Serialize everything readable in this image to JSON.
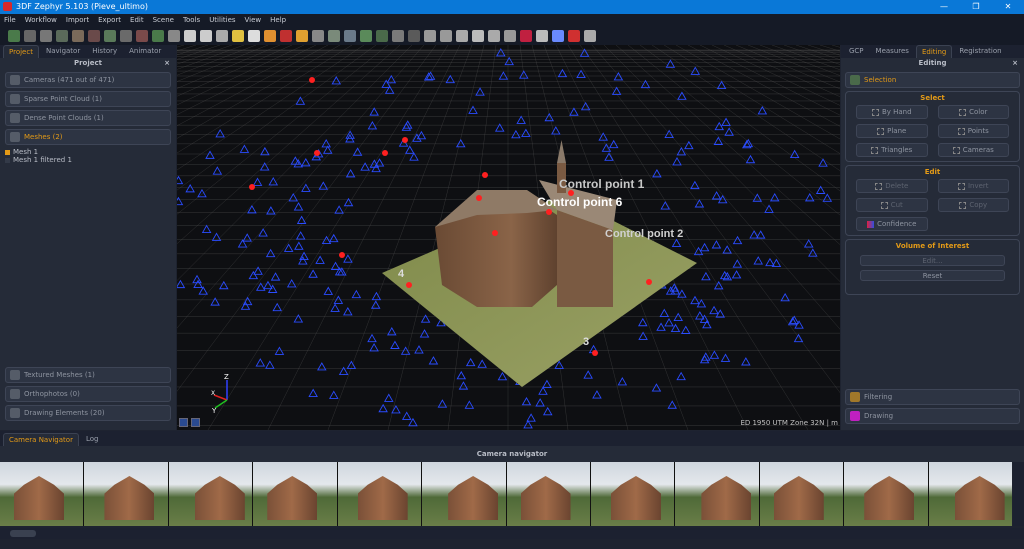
{
  "window": {
    "title": "3DF Zephyr 5.103 (Pieve_ultimo)",
    "controls": [
      "—",
      "❐",
      "✕"
    ]
  },
  "menu": [
    "File",
    "Workflow",
    "Import",
    "Export",
    "Edit",
    "Scene",
    "Tools",
    "Utilities",
    "View",
    "Help"
  ],
  "left_panel": {
    "tabs": [
      "Project",
      "Navigator",
      "History",
      "Animator"
    ],
    "active_tab": "Project",
    "title": "Project",
    "close": "×",
    "items": [
      {
        "label": "Cameras (471 out of 471)",
        "icon": "camera-icon"
      },
      {
        "label": "Sparse Point Cloud (1)",
        "icon": "sparse-cloud-icon"
      },
      {
        "label": "Dense Point Clouds (1)",
        "icon": "dense-cloud-icon"
      },
      {
        "label": "Meshes (2)",
        "icon": "mesh-icon",
        "selected": true
      }
    ],
    "meshes": [
      {
        "label": "Mesh 1",
        "checked": true
      },
      {
        "label": "Mesh 1 filtered 1",
        "checked": false
      }
    ],
    "bottom_items": [
      {
        "label": "Textured Meshes (1)",
        "icon": "textured-mesh-icon"
      },
      {
        "label": "Orthophotos (0)",
        "icon": "orthophoto-icon"
      },
      {
        "label": "Drawing Elements (20)",
        "icon": "drawing-icon"
      }
    ]
  },
  "viewport": {
    "labels": [
      "Control  point  1",
      "Control  point  6",
      "Control  point  2",
      "4",
      "3"
    ],
    "axes": [
      "Z",
      "X",
      "Y"
    ],
    "status": "ED 1950 UTM Zone 32N | m"
  },
  "right_panel": {
    "tabs": [
      "GCP",
      "Measures",
      "Editing",
      "Registration"
    ],
    "active_tab": "Editing",
    "title": "Editing",
    "close": "×",
    "selection": "Selection",
    "select": {
      "title": "Select",
      "buttons": [
        "By Hand",
        "Color",
        "Plane",
        "Points",
        "Triangles",
        "Cameras"
      ]
    },
    "edit": {
      "title": "Edit",
      "buttons": [
        "Delete",
        "Invert",
        "Cut",
        "Copy"
      ],
      "confidence": "Confidence"
    },
    "voi": {
      "title": "Volume of Interest",
      "buttons": [
        "Edit...",
        "Reset"
      ]
    },
    "filtering": "Filtering",
    "drawing": "Drawing"
  },
  "bottom": {
    "tabs": [
      "Camera Navigator",
      "Log"
    ],
    "active_tab": "Camera Navigator",
    "title": "Camera navigator"
  },
  "colors": {
    "accent": "#e39a17",
    "titlebar": "#0a78d7",
    "control_point": "#ff2020",
    "camera": "#2a4cff"
  }
}
